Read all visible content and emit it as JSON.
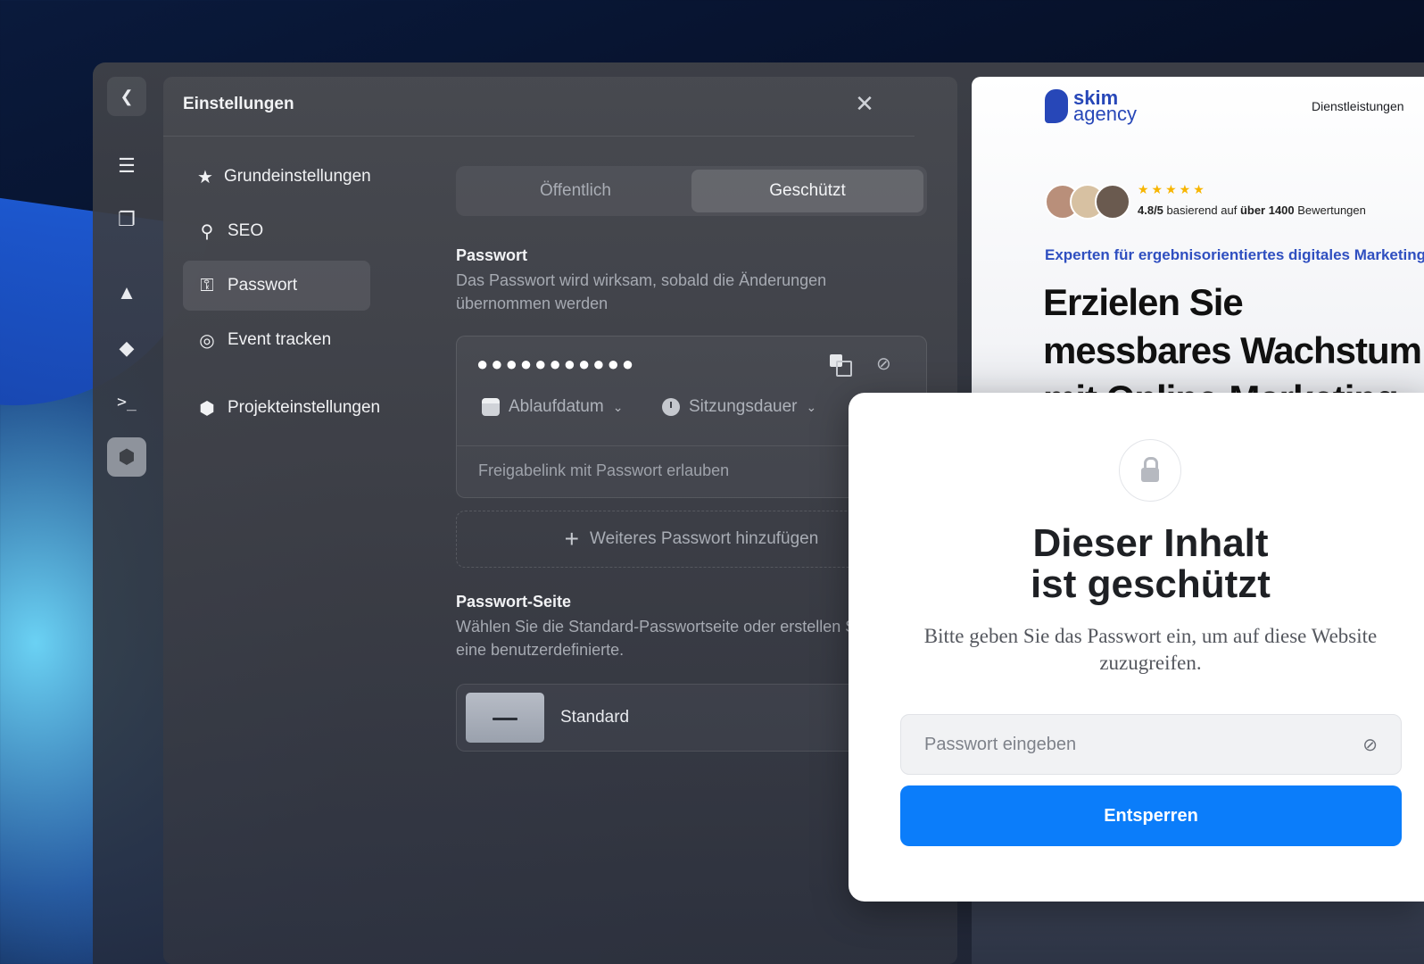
{
  "settings": {
    "title": "Einstellungen",
    "nav": [
      {
        "label": "Grundeinstellungen",
        "icon": "star-icon"
      },
      {
        "label": "SEO",
        "icon": "search-icon"
      },
      {
        "label": "Passwort",
        "icon": "key-icon"
      },
      {
        "label": "Event tracken",
        "icon": "target-icon"
      },
      {
        "label": "Projekteinstellungen",
        "icon": "hexagon-gear-icon"
      }
    ],
    "active_nav": "Passwort",
    "visibility_tabs": [
      "Öffentlich",
      "Geschützt"
    ],
    "active_visibility": "Geschützt",
    "password_section": {
      "title": "Passwort",
      "description": "Das Passwort wird wirksam, sobald die Änderungen übernommen werden",
      "masked_value": "●●●●●●●●●●●",
      "expiry_label": "Ablaufdatum",
      "session_label": "Sitzungsdauer",
      "share_link_label": "Freigabelink mit Passwort erlauben",
      "add_password_label": "Weiteres Passwort hinzufügen"
    },
    "password_page_section": {
      "title": "Passwort-Seite",
      "description": "Wählen Sie die Standard-Passwortseite oder erstellen Sie eine benutzerdefinierte.",
      "option_label": "Standard"
    }
  },
  "site": {
    "logo_line1": "skim",
    "logo_line2": "agency",
    "nav_item": "Dienstleistungen",
    "stars": "★★★★★",
    "rating_score": "4.8/5",
    "rating_mid": " basierend auf ",
    "rating_count": "über 1400",
    "rating_tail": " Bewertungen",
    "tagline": "Experten für ergebnisorientiertes digitales Marketing",
    "headline": "Erzielen Sie messbares Wachstum mit Online-Marketing"
  },
  "lock_dialog": {
    "title_line1": "Dieser Inhalt",
    "title_line2": "ist geschützt",
    "description": "Bitte geben Sie das Passwort ein, um auf diese Website zuzugreifen.",
    "input_placeholder": "Passwort eingeben",
    "button_label": "Entsperren"
  },
  "colors": {
    "accent": "#0b7dfa",
    "brand": "#2747b8",
    "star": "#f7b500"
  }
}
